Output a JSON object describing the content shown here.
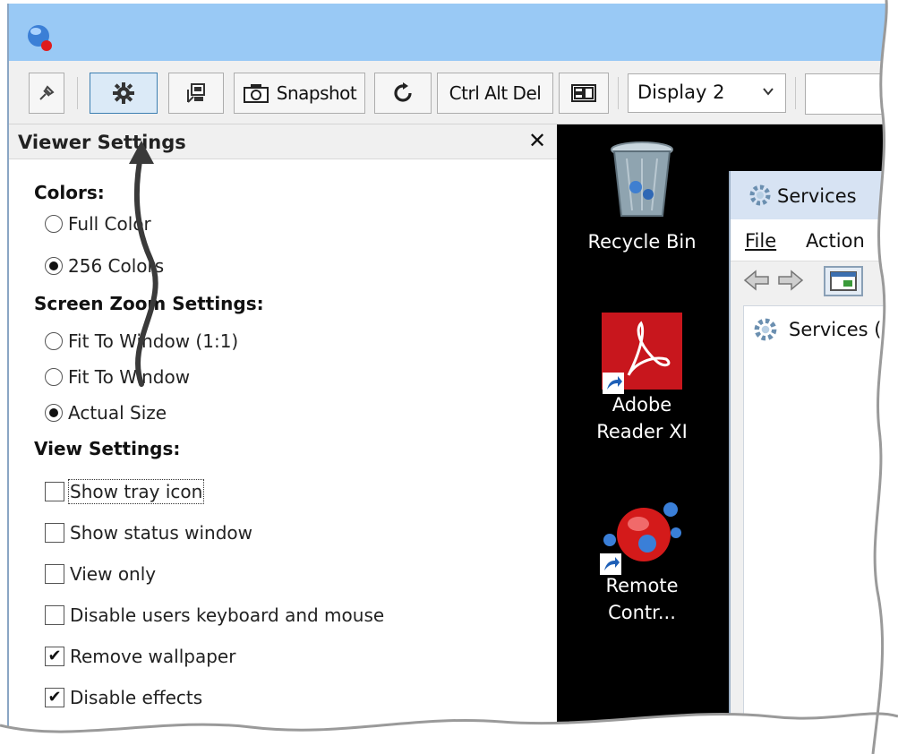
{
  "toolbar": {
    "snapshot_label": "Snapshot",
    "ctrl_alt_del_label": "Ctrl Alt Del",
    "display_select_value": "Display 2"
  },
  "panel": {
    "title": "Viewer Settings",
    "close_glyph": "✕",
    "colors": {
      "heading": "Colors:",
      "options": [
        {
          "label": "Full Color",
          "selected": false
        },
        {
          "label": "256 Colors",
          "selected": true
        }
      ]
    },
    "zoom": {
      "heading": "Screen Zoom Settings:",
      "options": [
        {
          "label": "Fit To Window (1:1)",
          "selected": false
        },
        {
          "label": "Fit To Window",
          "selected": false
        },
        {
          "label": "Actual Size",
          "selected": true
        }
      ]
    },
    "view": {
      "heading": "View Settings:",
      "options": [
        {
          "label": "Show tray icon",
          "checked": false
        },
        {
          "label": "Show status window",
          "checked": false
        },
        {
          "label": "View only",
          "checked": false
        },
        {
          "label": "Disable users keyboard and mouse",
          "checked": false
        },
        {
          "label": "Remove wallpaper",
          "checked": true
        },
        {
          "label": "Disable effects",
          "checked": true
        }
      ]
    }
  },
  "desktop": {
    "icons": [
      {
        "label_line1": "Recycle Bin",
        "label_line2": ""
      },
      {
        "label_line1": "Adobe",
        "label_line2": "Reader XI"
      },
      {
        "label_line1": "Remote",
        "label_line2": "Contr..."
      }
    ],
    "services_window": {
      "title": "Services",
      "menu": [
        "File",
        "Action"
      ],
      "tree_node": "Services (l"
    }
  },
  "colors": {
    "titlebar": "#99c9f5",
    "accent": "#3c7fb1",
    "desktop_bg": "#000000"
  },
  "icons": [
    "app-icon",
    "pin-icon",
    "gear-icon",
    "screen-control-icon",
    "camera-icon",
    "refresh-icon",
    "window-layout-icon",
    "chevron-down-icon",
    "recycle-bin-icon",
    "adobe-reader-icon",
    "remote-control-icon",
    "shortcut-arrow-icon",
    "services-gear-icon",
    "back-arrow-icon",
    "forward-arrow-icon",
    "console-view-icon"
  ]
}
